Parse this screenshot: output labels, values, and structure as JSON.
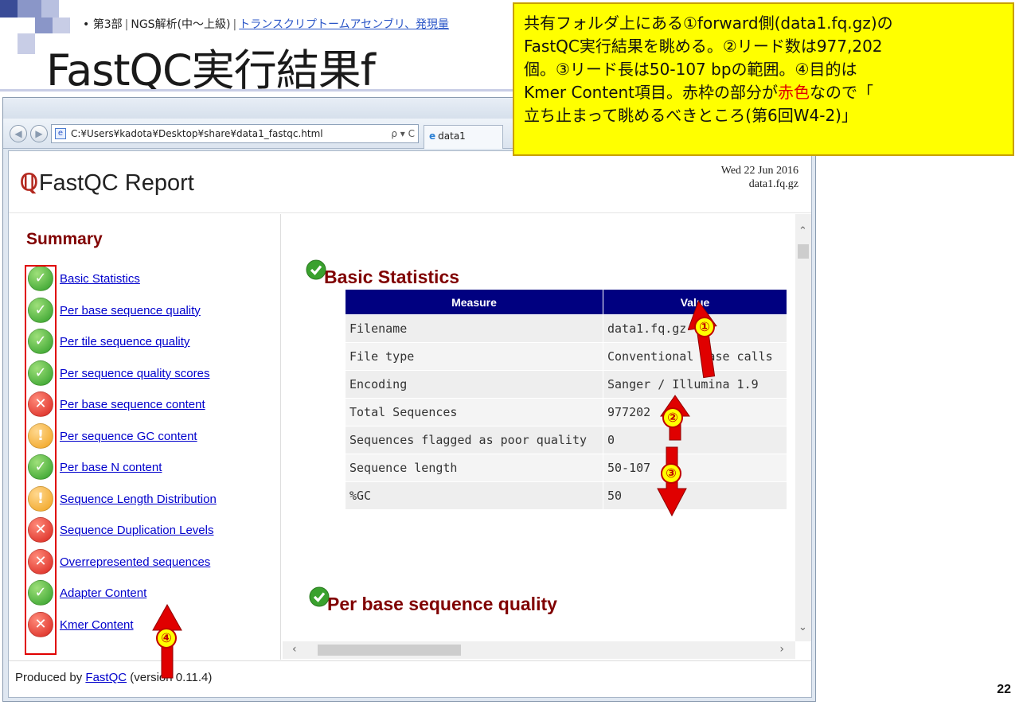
{
  "slide": {
    "breadcrumb_section": "第3部",
    "breadcrumb_course": "NGS解析(中～上級)",
    "breadcrumb_link": "トランスクリプトームアセンブリ、発現量",
    "title": "FastQC実行結果f",
    "page_number": "22"
  },
  "callout": {
    "line1": "共有フォルダ上にある①forward側(data1.fq.gz)の",
    "line2": "FastQC実行結果を眺める。②リード数は977,202",
    "line3": "個。③リード長は50-107 bpの範囲。④目的は",
    "line4_pre": "Kmer Content項目。赤枠の部分が",
    "line4_red": "赤色",
    "line4_post": "なので「",
    "line5": "立ち止まって眺めるべきところ(第6回W4-2)」"
  },
  "browser": {
    "url": "C:¥Users¥kadota¥Desktop¥share¥data1_fastqc.html",
    "address_controls": "ρ ▾ C",
    "tab_label": "data1"
  },
  "report": {
    "logo_text": "FastQC Report",
    "date": "Wed 22 Jun 2016",
    "filename": "data1.fq.gz",
    "summary_title": "Summary",
    "modules": [
      {
        "label": "Basic Statistics",
        "status": "pass"
      },
      {
        "label": "Per base sequence quality",
        "status": "pass"
      },
      {
        "label": "Per tile sequence quality",
        "status": "pass"
      },
      {
        "label": "Per sequence quality scores",
        "status": "pass"
      },
      {
        "label": "Per base sequence content",
        "status": "fail"
      },
      {
        "label": "Per sequence GC content",
        "status": "warn"
      },
      {
        "label": "Per base N content",
        "status": "pass"
      },
      {
        "label": "Sequence Length Distribution",
        "status": "warn"
      },
      {
        "label": "Sequence Duplication Levels",
        "status": "fail"
      },
      {
        "label": "Overrepresented sequences",
        "status": "fail"
      },
      {
        "label": "Adapter Content",
        "status": "pass"
      },
      {
        "label": "Kmer Content",
        "status": "fail"
      }
    ],
    "basic_stats_title": "Basic Statistics",
    "table_headers": [
      "Measure",
      "Value"
    ],
    "table_rows": [
      [
        "Filename",
        "data1.fq.gz"
      ],
      [
        "File type",
        "Conventional base calls"
      ],
      [
        "Encoding",
        "Sanger / Illumina 1.9"
      ],
      [
        "Total Sequences",
        "977202"
      ],
      [
        "Sequences flagged as poor quality",
        "0"
      ],
      [
        "Sequence length",
        "50-107"
      ],
      [
        "%GC",
        "50"
      ]
    ],
    "next_section_title": "Per base sequence quality",
    "footer_pre": "Produced by",
    "footer_link": "FastQC",
    "footer_post": "(version 0.11.4)"
  },
  "annotations": [
    "①",
    "②",
    "③",
    "④"
  ],
  "colors": {
    "callout_bg": "#ffff00",
    "annotation_red": "#e00000",
    "table_header": "#000080",
    "section_title": "#800000"
  }
}
